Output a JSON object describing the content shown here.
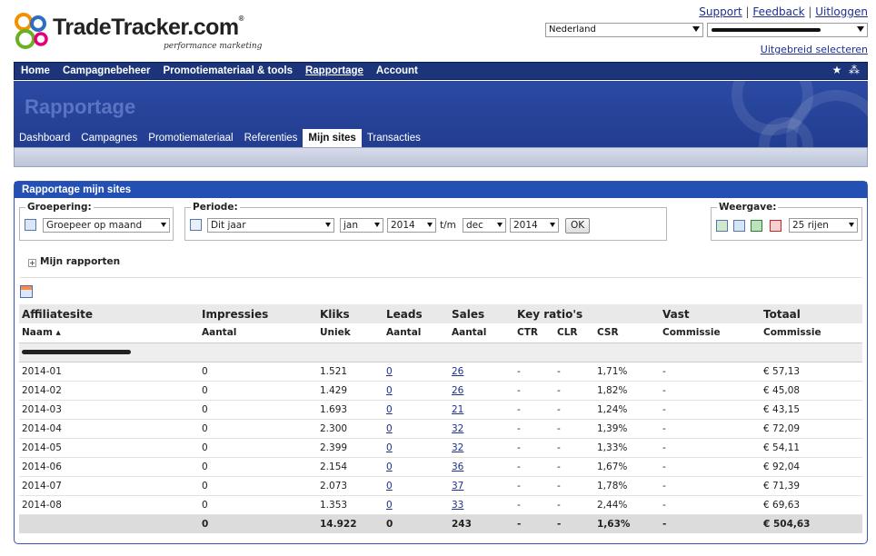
{
  "brand": {
    "name": "TradeTracker.com",
    "reg": "®",
    "tagline": "performance marketing"
  },
  "toplinks": {
    "support": "Support",
    "feedback": "Feedback",
    "logout": "Uitloggen",
    "sep": "|"
  },
  "country_select": {
    "value": "Nederland"
  },
  "advanced_select": "Uitgebreid selecteren",
  "mainnav": [
    "Home",
    "Campagnebeheer",
    "Promotiemateriaal & tools",
    "Rapportage",
    "Account"
  ],
  "mainnav_active": "Rapportage",
  "mainnav_icons": {
    "star": "★",
    "sitemap": "⁂"
  },
  "banner_title": "Rapportage",
  "subnav": [
    "Dashboard",
    "Campagnes",
    "Promotiemateriaal",
    "Referenties",
    "Mijn sites",
    "Transacties"
  ],
  "subnav_active": "Mijn sites",
  "panel_title": "Rapportage mijn sites",
  "filters": {
    "grouping": {
      "label": "Groepering:",
      "value": "Groepeer op maand"
    },
    "period": {
      "label": "Periode:",
      "range": "Dit jaar",
      "from_month": "jan",
      "from_year": "2014",
      "until": "t/m",
      "to_month": "dec",
      "to_year": "2014",
      "ok": "OK"
    },
    "view": {
      "label": "Weergave:",
      "rows": "25 rijen"
    }
  },
  "my_reports": {
    "plus": "+",
    "label": "Mijn rapporten"
  },
  "table": {
    "group_headers": [
      "Affiliatesite",
      "Impressies",
      "Kliks",
      "Leads",
      "Sales",
      "Key ratio's",
      "Vast",
      "Totaal"
    ],
    "sub_headers": [
      "Naam ▴",
      "Aantal",
      "Uniek",
      "Aantal",
      "Aantal",
      "CTR",
      "CLR",
      "CSR",
      "Commissie",
      "Commissie"
    ],
    "rows": [
      [
        "2014-01",
        "0",
        "1.521",
        "0",
        "26",
        "-",
        "-",
        "1,71%",
        "-",
        "€ 57,13"
      ],
      [
        "2014-02",
        "0",
        "1.429",
        "0",
        "26",
        "-",
        "-",
        "1,82%",
        "-",
        "€ 45,08"
      ],
      [
        "2014-03",
        "0",
        "1.693",
        "0",
        "21",
        "-",
        "-",
        "1,24%",
        "-",
        "€ 43,15"
      ],
      [
        "2014-04",
        "0",
        "2.300",
        "0",
        "32",
        "-",
        "-",
        "1,39%",
        "-",
        "€ 72,09"
      ],
      [
        "2014-05",
        "0",
        "2.399",
        "0",
        "32",
        "-",
        "-",
        "1,33%",
        "-",
        "€ 54,11"
      ],
      [
        "2014-06",
        "0",
        "2.154",
        "0",
        "36",
        "-",
        "-",
        "1,67%",
        "-",
        "€ 92,04"
      ],
      [
        "2014-07",
        "0",
        "2.073",
        "0",
        "37",
        "-",
        "-",
        "1,78%",
        "-",
        "€ 71,39"
      ],
      [
        "2014-08",
        "0",
        "1.353",
        "0",
        "33",
        "-",
        "-",
        "2,44%",
        "-",
        "€ 69,63"
      ]
    ],
    "totals": [
      "",
      "0",
      "14.922",
      "0",
      "243",
      "-",
      "-",
      "1,63%",
      "-",
      "€ 504,63"
    ]
  },
  "colors": {
    "nav": "#1c3479",
    "panel_head": "#2450b3",
    "link": "#1c2f8f"
  }
}
